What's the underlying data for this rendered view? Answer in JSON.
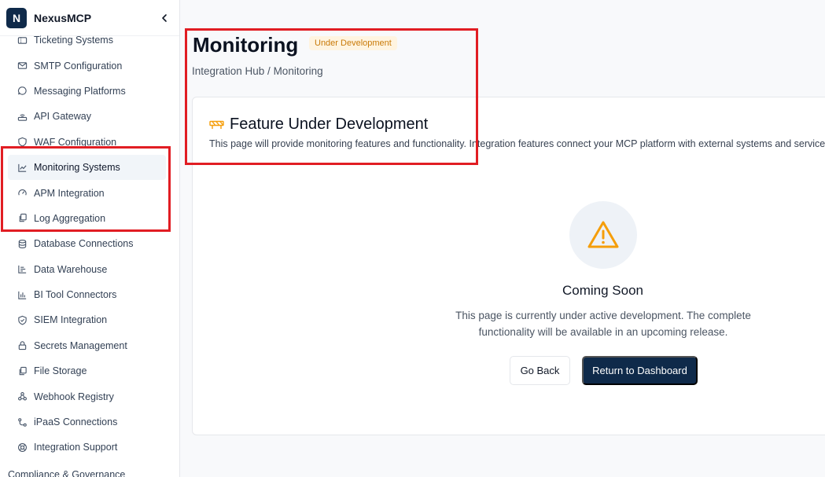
{
  "brand": {
    "logo_letter": "N",
    "name": "NexusMCP"
  },
  "sidebar": {
    "items": [
      {
        "label": "Ticketing Systems",
        "icon": "ticket-icon"
      },
      {
        "label": "SMTP Configuration",
        "icon": "mail-icon"
      },
      {
        "label": "Messaging Platforms",
        "icon": "chat-icon"
      },
      {
        "label": "API Gateway",
        "icon": "router-icon"
      },
      {
        "label": "WAF Configuration",
        "icon": "shield-icon"
      },
      {
        "label": "Monitoring Systems",
        "icon": "line-chart-icon",
        "active": true
      },
      {
        "label": "APM Integration",
        "icon": "gauge-icon"
      },
      {
        "label": "Log Aggregation",
        "icon": "files-icon"
      },
      {
        "label": "Database Connections",
        "icon": "database-icon"
      },
      {
        "label": "Data Warehouse",
        "icon": "bars-icon"
      },
      {
        "label": "BI Tool Connectors",
        "icon": "bar-chart-icon"
      },
      {
        "label": "SIEM Integration",
        "icon": "shield-check-icon"
      },
      {
        "label": "Secrets Management",
        "icon": "lock-icon"
      },
      {
        "label": "File Storage",
        "icon": "files-icon"
      },
      {
        "label": "Webhook Registry",
        "icon": "webhook-icon"
      },
      {
        "label": "iPaaS Connections",
        "icon": "share-icon"
      },
      {
        "label": "Integration Support",
        "icon": "lifebuoy-icon"
      }
    ],
    "next_section": "Compliance & Governance"
  },
  "page": {
    "title": "Monitoring",
    "badge": "Under Development",
    "breadcrumb": "Integration Hub / Monitoring"
  },
  "card": {
    "title": "Feature Under Development",
    "description": "This page will provide monitoring features and functionality. Integration features connect your MCP platform with external systems and services.",
    "coming_soon_title": "Coming Soon",
    "coming_soon_text": "This page is currently under active development. The complete functionality will be available in an upcoming release.",
    "back_button": "Go Back",
    "dashboard_button": "Return to Dashboard"
  },
  "colors": {
    "brand": "#0f2a4a",
    "badge_bg": "#fff4e0",
    "badge_text": "#c97a08",
    "warning": "#f59e0b",
    "highlight": "#e11d23"
  }
}
